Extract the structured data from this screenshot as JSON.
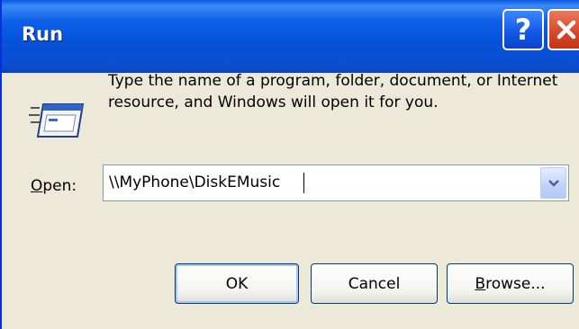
{
  "window": {
    "title": "Run",
    "help_label": "?"
  },
  "dialog": {
    "description": "Type the name of a program, folder, document, or Internet resource, and Windows will open it for you.",
    "open_label_underlined": "O",
    "open_label_rest": "pen:",
    "open_value": "\\\\MyPhone\\DiskEMusic"
  },
  "buttons": {
    "ok": "OK",
    "cancel": "Cancel",
    "browse_underlined": "B",
    "browse_rest": "rowse..."
  },
  "icons": {
    "help": "help-icon",
    "close": "close-icon",
    "run": "run-program-icon",
    "dropdown": "chevron-down-icon"
  },
  "colors": {
    "titlebar": "#0552d9",
    "dialog_bg": "#ece9d8",
    "close_btn": "#d6462a"
  }
}
